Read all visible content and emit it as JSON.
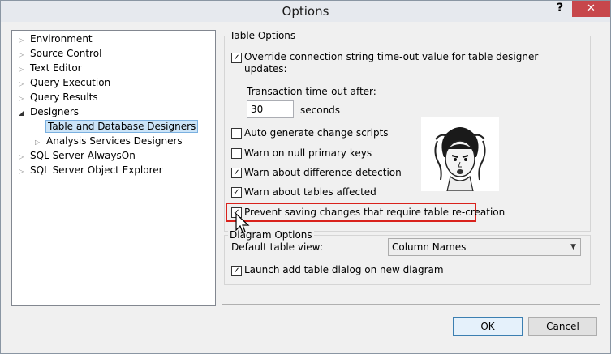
{
  "window": {
    "title": "Options",
    "help_label": "?",
    "close_label": "✕"
  },
  "tree": {
    "items": [
      {
        "label": "Environment",
        "expanded": false
      },
      {
        "label": "Source Control",
        "expanded": false
      },
      {
        "label": "Text Editor",
        "expanded": false
      },
      {
        "label": "Query Execution",
        "expanded": false
      },
      {
        "label": "Query Results",
        "expanded": false
      },
      {
        "label": "Designers",
        "expanded": true
      },
      {
        "label": "Table and Database Designers",
        "selected": true
      },
      {
        "label": "Analysis Services Designers",
        "expanded": false
      },
      {
        "label": "SQL Server AlwaysOn",
        "expanded": false
      },
      {
        "label": "SQL Server Object Explorer",
        "expanded": false
      }
    ]
  },
  "table_options": {
    "group_label": "Table Options",
    "override_timeout": {
      "label_line1": "Override connection string time-out value for table designer",
      "label_line2": "updates:",
      "checked": true
    },
    "transaction_timeout_label": "Transaction time-out after:",
    "timeout_value": "30",
    "seconds_label": "seconds",
    "auto_generate": {
      "label": "Auto generate change scripts",
      "checked": false
    },
    "warn_null_pk": {
      "label": "Warn on null primary keys",
      "checked": false
    },
    "warn_difference": {
      "label": "Warn about difference detection",
      "checked": true
    },
    "warn_tables_affected": {
      "label": "Warn about tables affected",
      "checked": true
    },
    "prevent_saving": {
      "label": "Prevent saving changes that require table re-creation",
      "checked": true
    }
  },
  "diagram_options": {
    "group_label": "Diagram Options",
    "default_view_label": "Default table view:",
    "default_view_value": "Column Names",
    "launch_add_table": {
      "label": "Launch add table dialog on new diagram",
      "checked": true
    }
  },
  "buttons": {
    "ok": "OK",
    "cancel": "Cancel"
  },
  "colors": {
    "highlight": "#d9221c",
    "close_button": "#c7474b",
    "selection": "#cce4f7"
  }
}
